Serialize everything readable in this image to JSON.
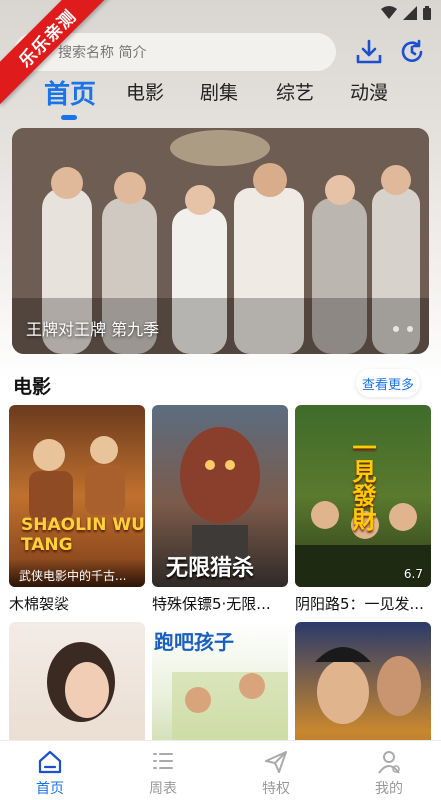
{
  "promo_badge": "乐乐亲测",
  "search": {
    "placeholder": "搜索名称 简介"
  },
  "header": {
    "download_icon": "download-icon",
    "history_icon": "history-icon"
  },
  "tabs": [
    {
      "label": "首页",
      "active": true
    },
    {
      "label": "电影",
      "active": false
    },
    {
      "label": "剧集",
      "active": false
    },
    {
      "label": "综艺",
      "active": false
    },
    {
      "label": "动漫",
      "active": false
    }
  ],
  "banner": {
    "caption": "王牌对王牌 第九季"
  },
  "movies_section": {
    "title": "电影",
    "see_more": "查看更多",
    "items": [
      {
        "title": "木棉袈裟",
        "poster_caption": "武侠电影中的千古...",
        "poster_text": "SHAOLIN WU TANG",
        "score": ""
      },
      {
        "title": "特殊保镖5·无限...",
        "poster_caption": "",
        "poster_text": "无限猎杀",
        "score": ""
      },
      {
        "title": "阴阳路5：一见发...",
        "poster_caption": "",
        "poster_text": "一見發財",
        "score": "6.7"
      },
      {
        "title": "",
        "poster_caption": "",
        "poster_text": "",
        "score": ""
      },
      {
        "title": "",
        "poster_caption": "",
        "poster_text": "跑吧孩子",
        "score": ""
      },
      {
        "title": "",
        "poster_caption": "",
        "poster_text": "",
        "score": ""
      }
    ]
  },
  "bottom_nav": [
    {
      "label": "首页",
      "icon": "home-icon",
      "active": true
    },
    {
      "label": "周表",
      "icon": "list-icon",
      "active": false
    },
    {
      "label": "特权",
      "icon": "send-icon",
      "active": false
    },
    {
      "label": "我的",
      "icon": "user-icon",
      "active": false
    }
  ],
  "colors": {
    "accent": "#1a73e8",
    "badge": "#e01b1b"
  }
}
